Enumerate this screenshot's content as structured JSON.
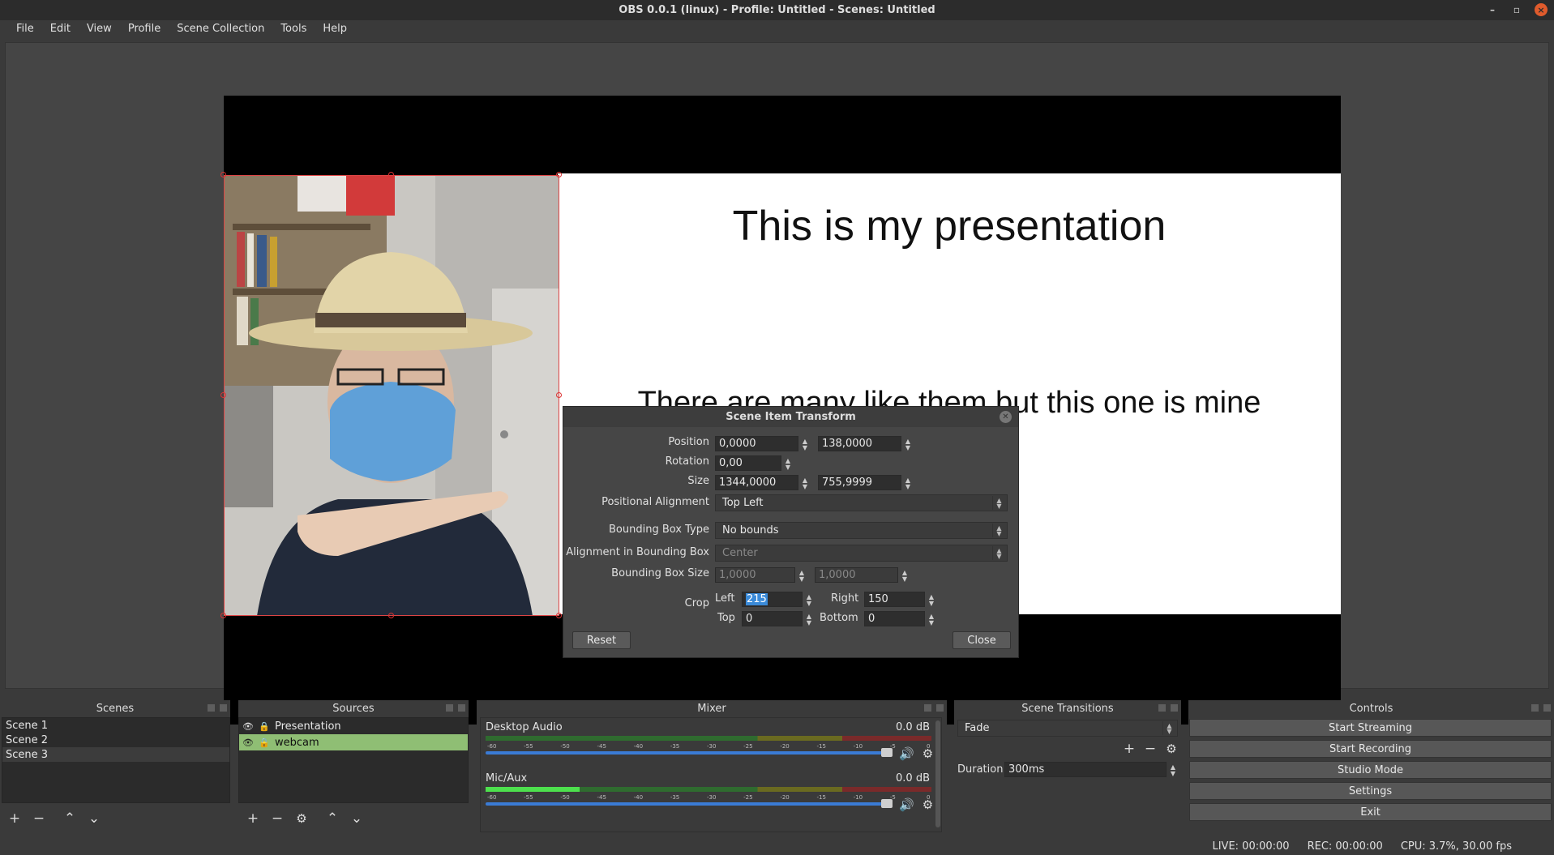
{
  "window": {
    "title": "OBS 0.0.1 (linux) - Profile: Untitled - Scenes: Untitled"
  },
  "menu": [
    "File",
    "Edit",
    "View",
    "Profile",
    "Scene Collection",
    "Tools",
    "Help"
  ],
  "preview": {
    "slide_title": "This is my presentation",
    "slide_subtitle": "There are many like them but this one is mine"
  },
  "transform_dialog": {
    "title": "Scene Item Transform",
    "position_label": "Position",
    "position_x": "0,0000",
    "position_y": "138,0000",
    "rotation_label": "Rotation",
    "rotation": "0,00",
    "size_label": "Size",
    "size_w": "1344,0000",
    "size_h": "755,9999",
    "pos_align_label": "Positional Alignment",
    "pos_align": "Top Left",
    "bbox_type_label": "Bounding Box Type",
    "bbox_type": "No bounds",
    "bbox_align_label": "Alignment in Bounding Box",
    "bbox_align": "Center",
    "bbox_size_label": "Bounding Box Size",
    "bbox_w": "1,0000",
    "bbox_h": "1,0000",
    "crop_label": "Crop",
    "crop_left_label": "Left",
    "crop_left": "215",
    "crop_right_label": "Right",
    "crop_right": "150",
    "crop_top_label": "Top",
    "crop_top": "0",
    "crop_bottom_label": "Bottom",
    "crop_bottom": "0",
    "reset_label": "Reset",
    "close_label": "Close"
  },
  "scenes": {
    "title": "Scenes",
    "items": [
      "Scene 1",
      "Scene 2",
      "Scene 3"
    ]
  },
  "sources": {
    "title": "Sources",
    "items": [
      "Presentation",
      "webcam"
    ]
  },
  "mixer": {
    "title": "Mixer",
    "channels": [
      {
        "name": "Desktop Audio",
        "db": "0.0 dB",
        "level": 0.0
      },
      {
        "name": "Mic/Aux",
        "db": "0.0 dB",
        "level": 0.21
      }
    ],
    "scale": [
      "-60",
      "-55",
      "-50",
      "-45",
      "-40",
      "-35",
      "-30",
      "-25",
      "-20",
      "-15",
      "-10",
      "-5",
      "0"
    ]
  },
  "transitions": {
    "title": "Scene Transitions",
    "selected": "Fade",
    "duration_label": "Duration",
    "duration": "300ms"
  },
  "controls": {
    "title": "Controls",
    "buttons": [
      "Start Streaming",
      "Start Recording",
      "Studio Mode",
      "Settings",
      "Exit"
    ]
  },
  "status": {
    "live": "LIVE: 00:00:00",
    "rec": "REC: 00:00:00",
    "cpu": "CPU: 3.7%, 30.00 fps"
  }
}
